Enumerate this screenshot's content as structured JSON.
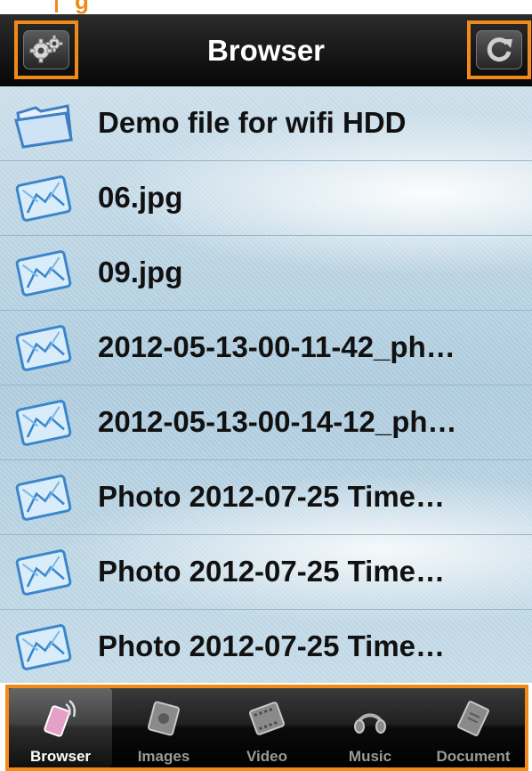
{
  "annotation": {
    "label": "g"
  },
  "navbar": {
    "title": "Browser"
  },
  "files": [
    {
      "name": "Demo file for wifi HDD",
      "icon": "folder-icon"
    },
    {
      "name": "06.jpg",
      "icon": "image-file-icon"
    },
    {
      "name": "09.jpg",
      "icon": "image-file-icon"
    },
    {
      "name": "2012-05-13-00-11-42_ph…",
      "icon": "image-file-icon"
    },
    {
      "name": "2012-05-13-00-14-12_ph…",
      "icon": "image-file-icon"
    },
    {
      "name": "Photo 2012-07-25 Time…",
      "icon": "image-file-icon"
    },
    {
      "name": "Photo 2012-07-25 Time…",
      "icon": "image-file-icon"
    },
    {
      "name": "Photo 2012-07-25 Time…",
      "icon": "image-file-icon"
    }
  ],
  "tabs": [
    {
      "label": "Browser",
      "icon": "browser-tab-icon",
      "active": true
    },
    {
      "label": "Images",
      "icon": "images-tab-icon",
      "active": false
    },
    {
      "label": "Video",
      "icon": "video-tab-icon",
      "active": false
    },
    {
      "label": "Music",
      "icon": "music-tab-icon",
      "active": false
    },
    {
      "label": "Document",
      "icon": "document-tab-icon",
      "active": false
    }
  ],
  "colors": {
    "annotation": "#f28a1a",
    "navbar": "#1b1b1b",
    "list_bg": "#b9d3e2"
  }
}
